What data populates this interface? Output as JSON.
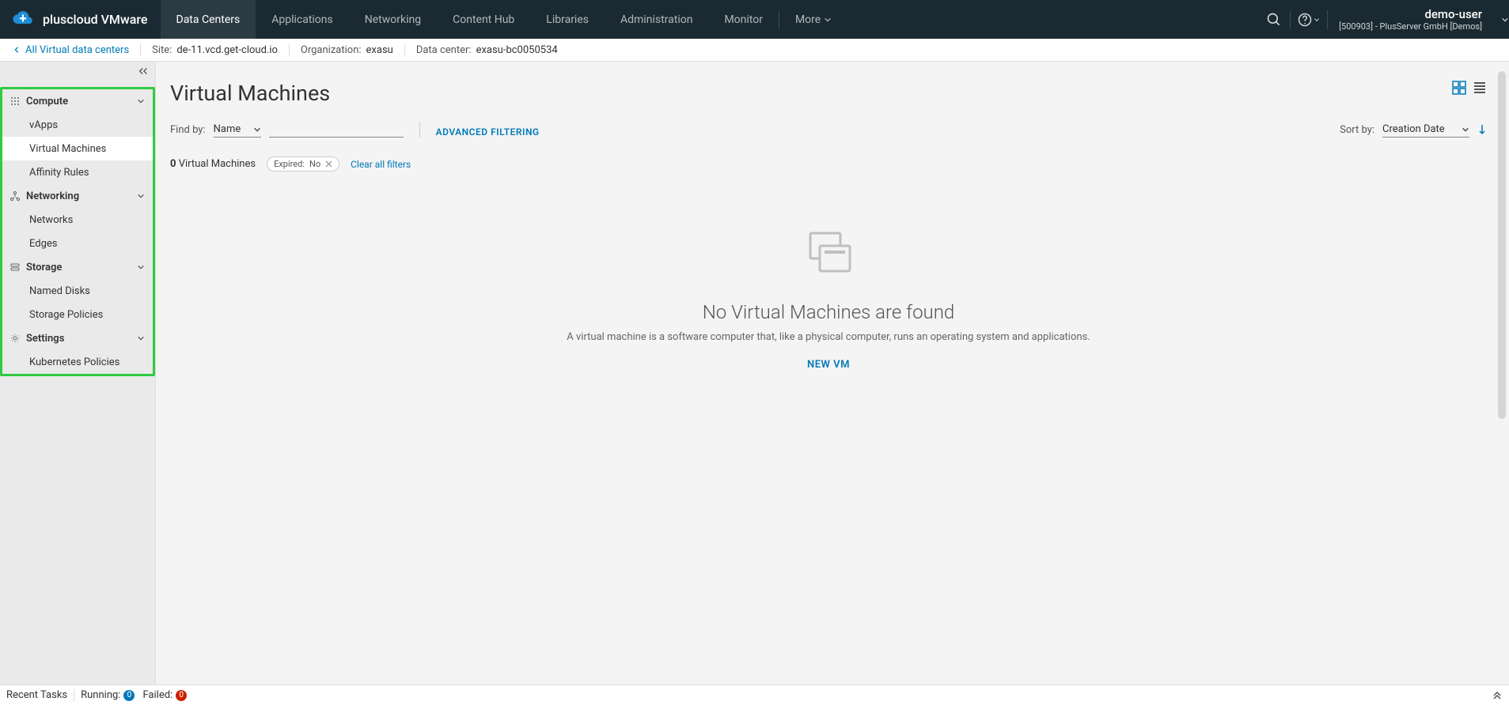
{
  "brand": {
    "name": "pluscloud VMware"
  },
  "nav": {
    "tabs": [
      {
        "label": "Data Centers",
        "active": true
      },
      {
        "label": "Applications"
      },
      {
        "label": "Networking"
      },
      {
        "label": "Content Hub"
      },
      {
        "label": "Libraries"
      },
      {
        "label": "Administration"
      },
      {
        "label": "Monitor"
      },
      {
        "label": "More",
        "caret": true
      }
    ]
  },
  "user": {
    "name": "demo-user",
    "org": "[500903] - PlusServer GmbH [Demos]"
  },
  "context": {
    "back_label": "All Virtual data centers",
    "site_key": "Site:",
    "site_val": "de-11.vcd.get-cloud.io",
    "org_key": "Organization:",
    "org_val": "exasu",
    "dc_key": "Data center:",
    "dc_val": "exasu-bc0050534"
  },
  "sidebar": {
    "groups": [
      {
        "label": "Compute",
        "items": [
          {
            "label": "vApps"
          },
          {
            "label": "Virtual Machines",
            "active": true
          },
          {
            "label": "Affinity Rules"
          }
        ]
      },
      {
        "label": "Networking",
        "items": [
          {
            "label": "Networks"
          },
          {
            "label": "Edges"
          }
        ]
      },
      {
        "label": "Storage",
        "items": [
          {
            "label": "Named Disks"
          },
          {
            "label": "Storage Policies"
          }
        ]
      },
      {
        "label": "Settings",
        "items": [
          {
            "label": "Kubernetes Policies"
          }
        ]
      }
    ]
  },
  "page": {
    "title": "Virtual Machines",
    "find_by_label": "Find by:",
    "find_by_field": "Name",
    "adv_filter": "ADVANCED FILTERING",
    "sort_by_label": "Sort by:",
    "sort_by_field": "Creation Date",
    "results_count": "0",
    "results_label": "Virtual Machines",
    "chip_key": "Expired:",
    "chip_val": "No",
    "clear_filters": "Clear all filters",
    "empty_title": "No Virtual Machines are found",
    "empty_desc": "A virtual machine is a software computer that, like a physical computer, runs an operating system and applications.",
    "new_vm": "NEW VM"
  },
  "bottom": {
    "label": "Recent Tasks",
    "running_label": "Running:",
    "running_count": "0",
    "failed_label": "Failed:",
    "failed_count": "0"
  }
}
